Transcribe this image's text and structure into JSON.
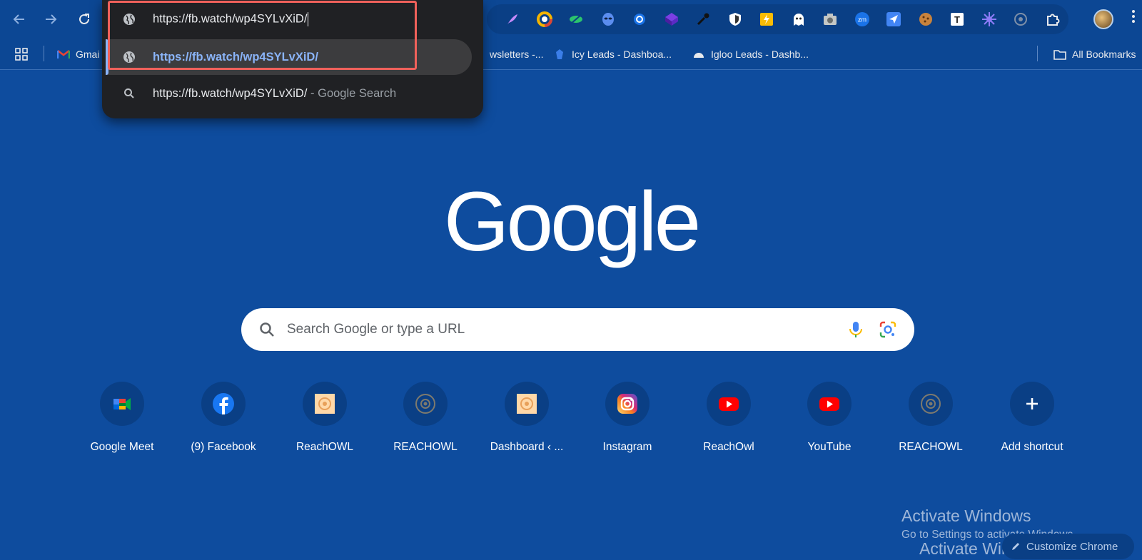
{
  "omnibox": {
    "input_value": "https://fb.watch/wp4SYLvXiD/",
    "suggestions": [
      {
        "text": "https://fb.watch/wp4SYLvXiD/",
        "type": "url"
      },
      {
        "text": "https://fb.watch/wp4SYLvXiD/",
        "suffix": "- Google Search",
        "type": "search"
      }
    ]
  },
  "bookmarks": {
    "gmail": "Gmai",
    "newsletters": "wsletters -...",
    "icy": "Icy Leads - Dashboa...",
    "igloo": "Igloo Leads - Dashb...",
    "all": "All Bookmarks"
  },
  "logo": "Google",
  "search": {
    "placeholder": "Search Google or type a URL"
  },
  "shortcuts": [
    {
      "label": "Google Meet",
      "icon": "google-meet-icon"
    },
    {
      "label": "(9) Facebook",
      "icon": "facebook-icon"
    },
    {
      "label": "ReachOWL",
      "icon": "reachowl-icon"
    },
    {
      "label": "REACHOWL",
      "icon": "reachowl-icon"
    },
    {
      "label": "Dashboard ‹ ...",
      "icon": "dashboard-icon"
    },
    {
      "label": "Instagram",
      "icon": "instagram-icon"
    },
    {
      "label": "ReachOwl",
      "icon": "youtube-icon"
    },
    {
      "label": "YouTube",
      "icon": "youtube-icon"
    },
    {
      "label": "REACHOWL",
      "icon": "reachowl-icon"
    },
    {
      "label": "Add shortcut",
      "icon": "plus-icon"
    }
  ],
  "watermark": {
    "title": "Activate Windows",
    "subtitle": "Go to Settings to activate Windows."
  },
  "customize": {
    "label": "Customize Chrome"
  },
  "colors": {
    "background": "#0e4c9e",
    "omnibox": "#202124",
    "link": "#8ab4f8",
    "highlight": "#f0615b"
  }
}
